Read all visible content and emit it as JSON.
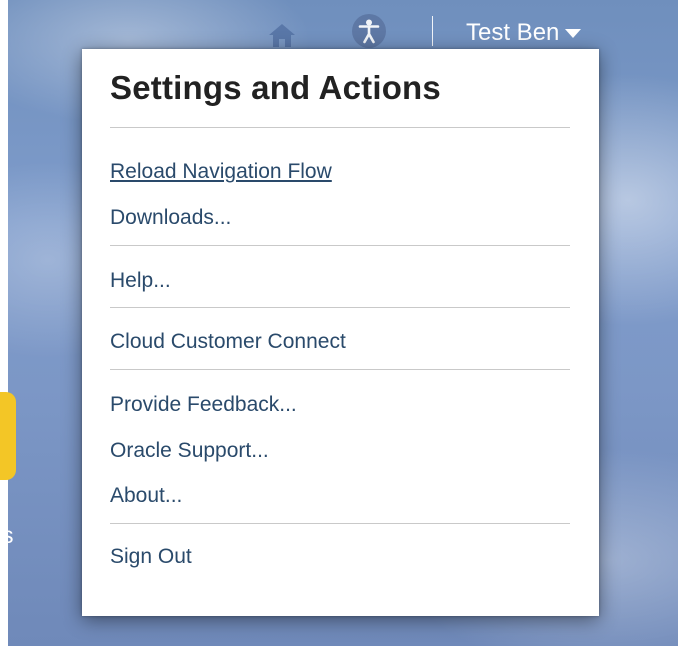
{
  "header": {
    "home_icon": "home-icon",
    "accessibility_icon": "accessibility-icon",
    "user_name": "Test Ben",
    "caret_icon": "caret-down-icon"
  },
  "background": {
    "edge_label": "s"
  },
  "settings_menu": {
    "title": "Settings and Actions",
    "items": [
      {
        "label": "Reload Navigation Flow"
      },
      {
        "label": "Downloads..."
      },
      {
        "label": "Help..."
      },
      {
        "label": "Cloud Customer Connect"
      },
      {
        "label": "Provide Feedback..."
      },
      {
        "label": "Oracle Support..."
      },
      {
        "label": "About..."
      },
      {
        "label": "Sign Out"
      }
    ]
  },
  "colors": {
    "link": "#2a4a6b",
    "background": "#7c97c6",
    "tile": "#f3c626"
  }
}
